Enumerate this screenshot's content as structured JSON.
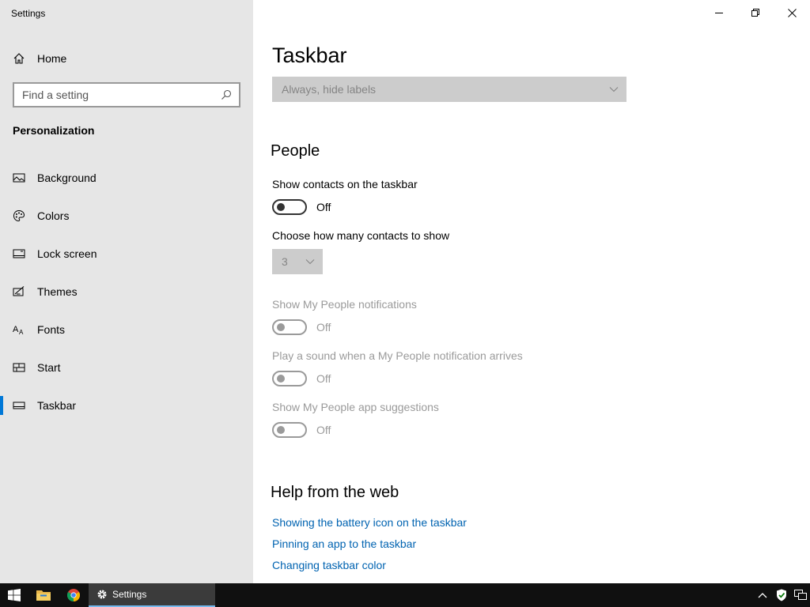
{
  "window": {
    "title": "Settings"
  },
  "sidebar": {
    "home_label": "Home",
    "search_placeholder": "Find a setting",
    "section_title": "Personalization",
    "items": [
      {
        "label": "Background",
        "icon": "picture-icon"
      },
      {
        "label": "Colors",
        "icon": "palette-icon"
      },
      {
        "label": "Lock screen",
        "icon": "lock-screen-icon"
      },
      {
        "label": "Themes",
        "icon": "themes-icon"
      },
      {
        "label": "Fonts",
        "icon": "fonts-icon"
      },
      {
        "label": "Start",
        "icon": "start-icon"
      },
      {
        "label": "Taskbar",
        "icon": "taskbar-icon",
        "active": true
      }
    ]
  },
  "main": {
    "page_title": "Taskbar",
    "combine_buttons_value": "Always, hide labels",
    "people": {
      "heading": "People",
      "show_contacts_label": "Show contacts on the taskbar",
      "show_contacts_state": "Off",
      "contacts_count_label": "Choose how many contacts to show",
      "contacts_count_value": "3",
      "notifications_label": "Show My People notifications",
      "notifications_state": "Off",
      "sound_label": "Play a sound when a My People notification arrives",
      "sound_state": "Off",
      "suggestions_label": "Show My People app suggestions",
      "suggestions_state": "Off"
    },
    "help": {
      "heading": "Help from the web",
      "links": [
        "Showing the battery icon on the taskbar",
        "Pinning an app to the taskbar",
        "Changing taskbar color"
      ]
    }
  },
  "taskbar": {
    "active_app_label": "Settings"
  },
  "colors": {
    "accent": "#0078d7",
    "link": "#0063b1",
    "sidebar_bg": "#e6e6e6",
    "taskbar_bg": "#101010",
    "disabled_text": "#9a9a9a"
  }
}
